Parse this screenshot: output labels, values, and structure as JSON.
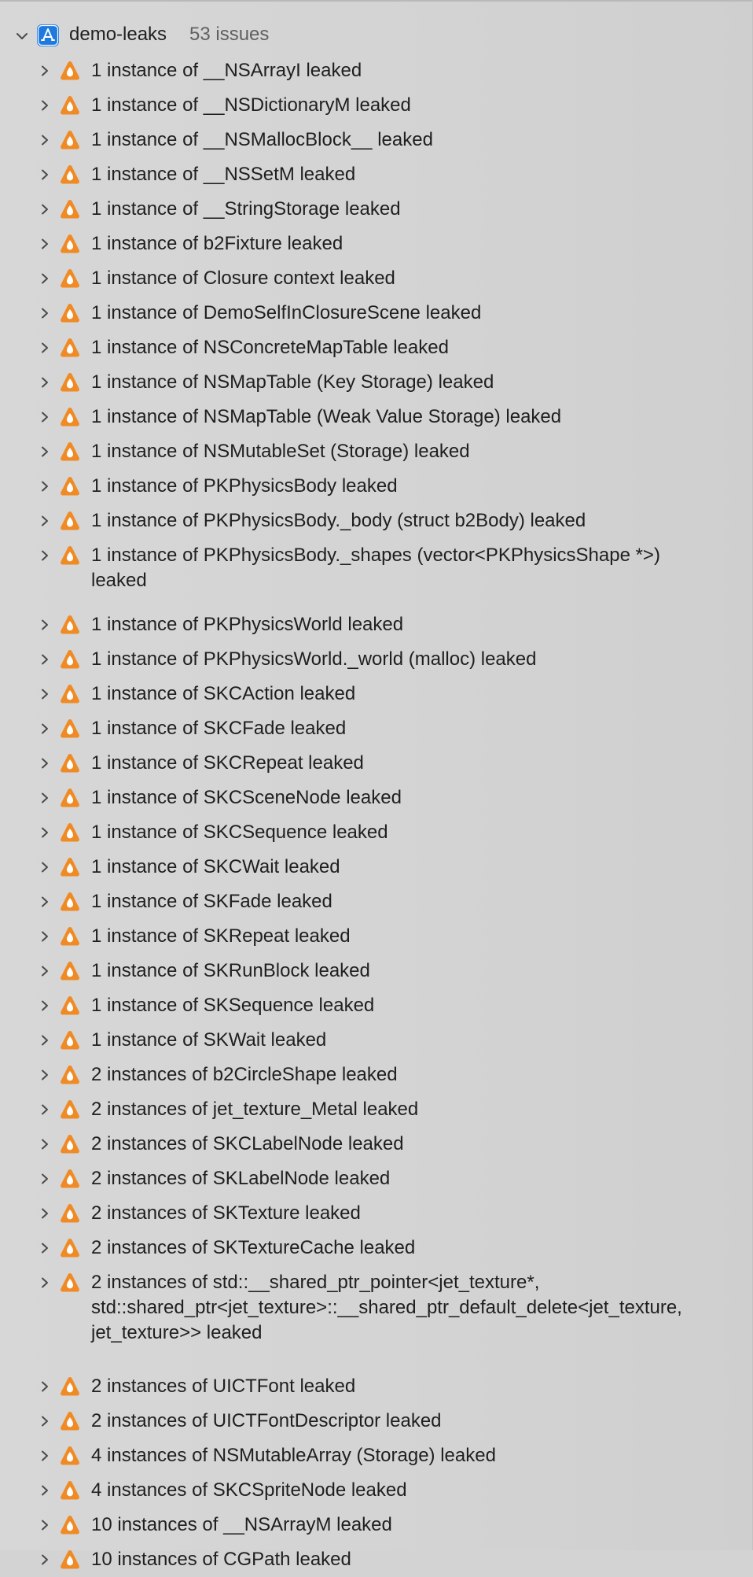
{
  "project": {
    "name": "demo-leaks",
    "issue_count": "53 issues",
    "icon": "app-project-icon"
  },
  "issues": [
    "1 instance of __NSArrayI leaked",
    "1 instance of __NSDictionaryM leaked",
    "1 instance of __NSMallocBlock__ leaked",
    "1 instance of __NSSetM leaked",
    "1 instance of __StringStorage leaked",
    "1 instance of b2Fixture leaked",
    "1 instance of Closure context leaked",
    "1 instance of DemoSelfInClosureScene leaked",
    "1 instance of NSConcreteMapTable leaked",
    "1 instance of NSMapTable (Key Storage) leaked",
    "1 instance of NSMapTable (Weak Value Storage) leaked",
    "1 instance of NSMutableSet (Storage) leaked",
    "1 instance of PKPhysicsBody leaked",
    "1 instance of PKPhysicsBody._body (struct b2Body) leaked",
    "1 instance of PKPhysicsBody._shapes (vector<PKPhysicsShape *>) leaked",
    "1 instance of PKPhysicsWorld leaked",
    "1 instance of PKPhysicsWorld._world (malloc) leaked",
    "1 instance of SKCAction leaked",
    "1 instance of SKCFade leaked",
    "1 instance of SKCRepeat leaked",
    "1 instance of SKCSceneNode leaked",
    "1 instance of SKCSequence leaked",
    "1 instance of SKCWait leaked",
    "1 instance of SKFade leaked",
    "1 instance of SKRepeat leaked",
    "1 instance of SKRunBlock leaked",
    "1 instance of SKSequence leaked",
    "1 instance of SKWait leaked",
    "2 instances of b2CircleShape leaked",
    "2 instances of jet_texture_Metal leaked",
    "2 instances of SKCLabelNode leaked",
    "2 instances of SKLabelNode leaked",
    "2 instances of SKTexture leaked",
    "2 instances of SKTextureCache leaked",
    "2 instances of std::__shared_ptr_pointer<jet_texture*, std::shared_ptr<jet_texture>::__shared_ptr_default_delete<jet_texture, jet_texture>> leaked",
    "2 instances of UICTFont leaked",
    "2 instances of UICTFontDescriptor leaked",
    "4 instances of NSMutableArray (Storage) leaked",
    "4 instances of SKCSpriteNode leaked",
    "10 instances of __NSArrayM leaked",
    "10 instances of CGPath leaked"
  ],
  "colors": {
    "warning": "#f08a24",
    "project_icon": "#1f7ae0"
  }
}
